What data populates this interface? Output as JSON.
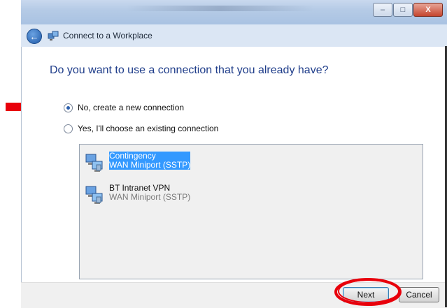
{
  "window": {
    "title": "Connect to a Workplace",
    "controls": {
      "minimize": "–",
      "maximize": "□",
      "close": "X"
    }
  },
  "heading": "Do you want to use a connection that you already have?",
  "options": [
    {
      "label": "No, create a new connection",
      "selected": true
    },
    {
      "label": "Yes, I'll choose an existing connection",
      "selected": false
    }
  ],
  "connections": [
    {
      "name": "Contingency",
      "type": "WAN Miniport (SSTP)",
      "selected": true,
      "icon": "network-connection-icon"
    },
    {
      "name": "BT Intranet VPN",
      "type": "WAN Miniport (SSTP)",
      "selected": false,
      "icon": "network-connection-icon"
    }
  ],
  "buttons": {
    "next": "Next",
    "cancel": "Cancel"
  },
  "colors": {
    "annotation_red": "#e8000b",
    "heading_blue": "#1f3d8a",
    "selection_blue": "#3399ff"
  }
}
